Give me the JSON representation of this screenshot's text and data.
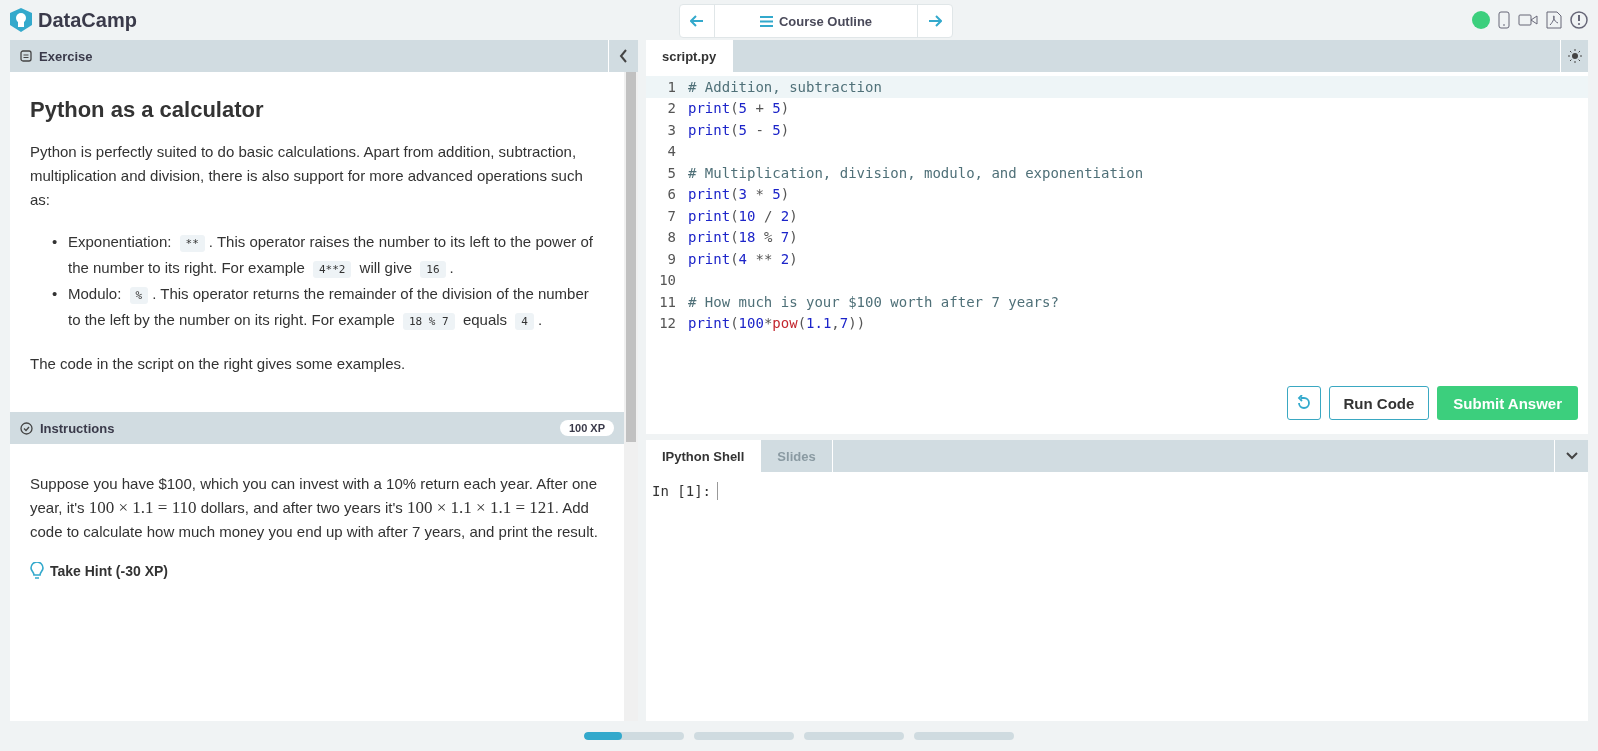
{
  "brand": "DataCamp",
  "nav": {
    "title": "Course Outline"
  },
  "status": {
    "color": "#3ccf7d"
  },
  "exercise": {
    "header": "Exercise",
    "title": "Python as a calculator",
    "intro": "Python is perfectly suited to do basic calculations. Apart from addition, subtraction, multiplication and division, there is also support for more advanced operations such as:",
    "bullets": [
      {
        "marker": "•",
        "parts": [
          {
            "kind": "text",
            "t": "Exponentiation: "
          },
          {
            "kind": "code",
            "t": "**"
          },
          {
            "kind": "text",
            "t": ". This operator raises the number to its left to the power of the number to its right. For example "
          },
          {
            "kind": "code",
            "t": "4**2"
          },
          {
            "kind": "text",
            "t": " will give "
          },
          {
            "kind": "code",
            "t": "16"
          },
          {
            "kind": "text",
            "t": "."
          }
        ]
      },
      {
        "marker": "•",
        "parts": [
          {
            "kind": "text",
            "t": "Modulo: "
          },
          {
            "kind": "code",
            "t": "%"
          },
          {
            "kind": "text",
            "t": ". This operator returns the remainder of the division of the number to the left by the number on its right. For example "
          },
          {
            "kind": "code",
            "t": "18 % 7"
          },
          {
            "kind": "text",
            "t": " equals "
          },
          {
            "kind": "code",
            "t": "4"
          },
          {
            "kind": "text",
            "t": "."
          }
        ]
      }
    ],
    "outro": "The code in the script on the right gives some examples."
  },
  "instructions": {
    "header": "Instructions",
    "xp": "100 XP",
    "text": [
      {
        "kind": "text",
        "t": "Suppose you have $100, which you can invest with a 10% return each year. After one year, it's "
      },
      {
        "kind": "math",
        "t": "100 × 1.1 = 110"
      },
      {
        "kind": "text",
        "t": " dollars, and after two years it's "
      },
      {
        "kind": "math",
        "t": "100 × 1.1 × 1.1 = 121"
      },
      {
        "kind": "text",
        "t": ". Add code to calculate how much money you end up with after 7 years, and print the result."
      }
    ],
    "hint": "Take Hint (-30 XP)"
  },
  "editor": {
    "tab": "script.py",
    "lines": [
      {
        "n": "1",
        "tokens": [
          {
            "kind": "comment",
            "t": "# Addition, subtraction"
          }
        ]
      },
      {
        "n": "2",
        "tokens": [
          {
            "kind": "func",
            "t": "print"
          },
          {
            "kind": "op",
            "t": "("
          },
          {
            "kind": "num",
            "t": "5"
          },
          {
            "kind": "op",
            "t": " + "
          },
          {
            "kind": "num",
            "t": "5"
          },
          {
            "kind": "op",
            "t": ")"
          }
        ]
      },
      {
        "n": "3",
        "tokens": [
          {
            "kind": "func",
            "t": "print"
          },
          {
            "kind": "op",
            "t": "("
          },
          {
            "kind": "num",
            "t": "5"
          },
          {
            "kind": "op",
            "t": " - "
          },
          {
            "kind": "num",
            "t": "5"
          },
          {
            "kind": "op",
            "t": ")"
          }
        ]
      },
      {
        "n": "4"
      },
      {
        "n": "5",
        "tokens": [
          {
            "kind": "comment",
            "t": "# Multiplication, division, modulo, and exponentiation"
          }
        ]
      },
      {
        "n": "6",
        "tokens": [
          {
            "kind": "func",
            "t": "print"
          },
          {
            "kind": "op",
            "t": "("
          },
          {
            "kind": "num",
            "t": "3"
          },
          {
            "kind": "op",
            "t": " * "
          },
          {
            "kind": "num",
            "t": "5"
          },
          {
            "kind": "op",
            "t": ")"
          }
        ]
      },
      {
        "n": "7",
        "tokens": [
          {
            "kind": "func",
            "t": "print"
          },
          {
            "kind": "op",
            "t": "("
          },
          {
            "kind": "num",
            "t": "10"
          },
          {
            "kind": "op",
            "t": " / "
          },
          {
            "kind": "num",
            "t": "2"
          },
          {
            "kind": "op",
            "t": ")"
          }
        ]
      },
      {
        "n": "8",
        "tokens": [
          {
            "kind": "func",
            "t": "print"
          },
          {
            "kind": "op",
            "t": "("
          },
          {
            "kind": "num",
            "t": "18"
          },
          {
            "kind": "op",
            "t": " % "
          },
          {
            "kind": "num",
            "t": "7"
          },
          {
            "kind": "op",
            "t": ")"
          }
        ]
      },
      {
        "n": "9",
        "tokens": [
          {
            "kind": "func",
            "t": "print"
          },
          {
            "kind": "op",
            "t": "("
          },
          {
            "kind": "num",
            "t": "4"
          },
          {
            "kind": "op",
            "t": " ** "
          },
          {
            "kind": "num",
            "t": "2"
          },
          {
            "kind": "op",
            "t": ")"
          }
        ]
      },
      {
        "n": "10"
      },
      {
        "n": "11",
        "tokens": [
          {
            "kind": "comment",
            "t": "# How much is your $100 worth after 7 years?"
          }
        ]
      },
      {
        "n": "12",
        "tokens": [
          {
            "kind": "func",
            "t": "print"
          },
          {
            "kind": "op",
            "t": "("
          },
          {
            "kind": "num",
            "t": "100"
          },
          {
            "kind": "op",
            "t": "*"
          },
          {
            "kind": "builtin",
            "t": "pow"
          },
          {
            "kind": "op",
            "t": "("
          },
          {
            "kind": "num",
            "t": "1.1"
          },
          {
            "kind": "op",
            "t": ","
          },
          {
            "kind": "num",
            "t": "7"
          },
          {
            "kind": "op",
            "t": "))"
          }
        ]
      }
    ]
  },
  "buttons": {
    "run": "Run Code",
    "submit": "Submit Answer"
  },
  "console": {
    "tabs": [
      {
        "label": "IPython Shell",
        "selected": true
      },
      {
        "label": "Slides",
        "selected": false
      }
    ],
    "prompt": "In [1]:"
  },
  "progress": [
    {
      "current": true,
      "level": 0.38
    },
    {
      "current": false
    },
    {
      "current": false
    },
    {
      "current": false
    }
  ]
}
